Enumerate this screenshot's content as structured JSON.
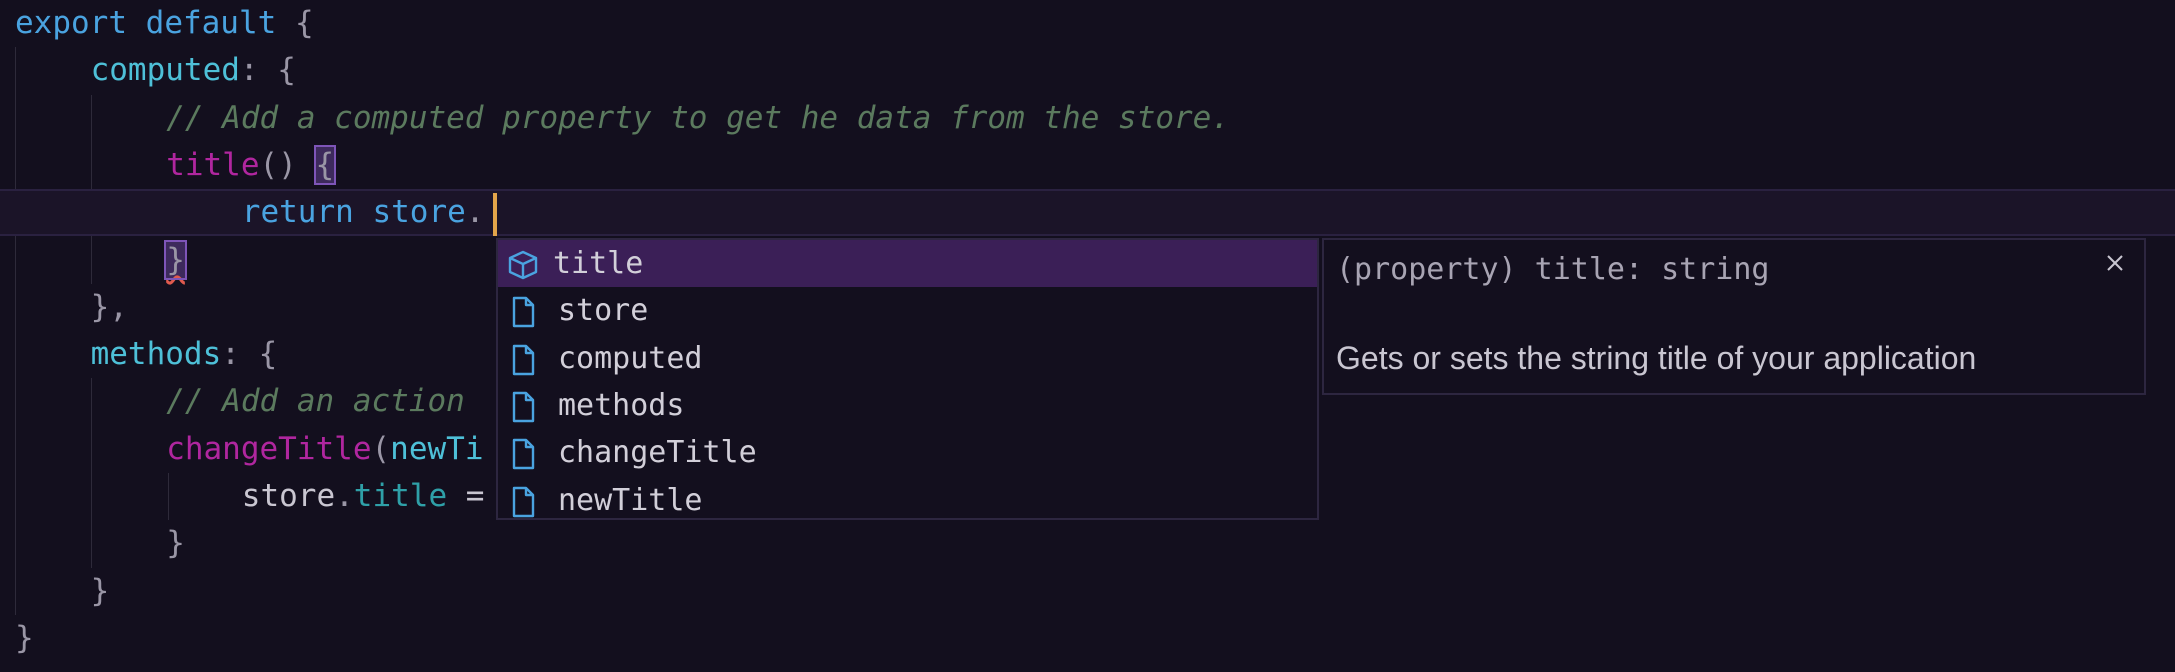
{
  "code": {
    "lines": [
      {
        "indent": 0,
        "tokens": [
          {
            "cls": "kw",
            "text": "export"
          },
          {
            "cls": "plain",
            "text": " "
          },
          {
            "cls": "kw",
            "text": "default"
          },
          {
            "cls": "plain",
            "text": " "
          },
          {
            "cls": "punc",
            "text": "{"
          }
        ]
      },
      {
        "indent": 4,
        "tokens": [
          {
            "cls": "prop",
            "text": "computed"
          },
          {
            "cls": "punc",
            "text": ": {"
          }
        ]
      },
      {
        "indent": 8,
        "tokens": [
          {
            "cls": "cm",
            "text": "// Add a computed property to get he data from the store."
          }
        ]
      },
      {
        "indent": 8,
        "tokens": [
          {
            "cls": "fn",
            "text": "title"
          },
          {
            "cls": "punc",
            "text": "() "
          },
          {
            "cls": "punc bracket-match",
            "text": "{"
          }
        ]
      },
      {
        "indent": 12,
        "current": true,
        "tokens": [
          {
            "cls": "kw",
            "text": "return"
          },
          {
            "cls": "plain",
            "text": " "
          },
          {
            "cls": "kw",
            "text": "store"
          },
          {
            "cls": "punc",
            "text": "."
          }
        ]
      },
      {
        "indent": 8,
        "tokens": [
          {
            "cls": "punc bracket-match squiggle",
            "text": "}"
          }
        ]
      },
      {
        "indent": 4,
        "tokens": [
          {
            "cls": "punc",
            "text": "},"
          }
        ]
      },
      {
        "indent": 4,
        "tokens": [
          {
            "cls": "prop",
            "text": "methods"
          },
          {
            "cls": "punc",
            "text": ": {"
          }
        ]
      },
      {
        "indent": 8,
        "tokens": [
          {
            "cls": "cm",
            "text": "// Add an action"
          }
        ]
      },
      {
        "indent": 8,
        "tokens": [
          {
            "cls": "fn",
            "text": "changeTitle"
          },
          {
            "cls": "punc",
            "text": "("
          },
          {
            "cls": "prop",
            "text": "newTi"
          }
        ]
      },
      {
        "indent": 12,
        "tokens": [
          {
            "cls": "plain",
            "text": "store"
          },
          {
            "cls": "punc",
            "text": "."
          },
          {
            "cls": "member",
            "text": "title"
          },
          {
            "cls": "plain",
            "text": " ="
          }
        ]
      },
      {
        "indent": 8,
        "tokens": [
          {
            "cls": "punc",
            "text": "}"
          }
        ]
      },
      {
        "indent": 4,
        "tokens": [
          {
            "cls": "punc",
            "text": "}"
          }
        ]
      },
      {
        "indent": 0,
        "tokens": [
          {
            "cls": "punc",
            "text": "}"
          }
        ]
      }
    ]
  },
  "suggest": {
    "items": [
      {
        "label": "title",
        "icon": "cube-icon",
        "selected": true
      },
      {
        "label": "store",
        "icon": "file-icon",
        "selected": false
      },
      {
        "label": "computed",
        "icon": "file-icon",
        "selected": false
      },
      {
        "label": "methods",
        "icon": "file-icon",
        "selected": false
      },
      {
        "label": "changeTitle",
        "icon": "file-icon",
        "selected": false
      },
      {
        "label": "newTitle",
        "icon": "file-icon",
        "selected": false
      }
    ]
  },
  "details": {
    "signature": "(property) title: string",
    "documentation": "Gets or sets the string title of your application",
    "close_icon": "close-icon"
  },
  "colors": {
    "background": "#130f1e",
    "keyword": "#4aa3e0",
    "function": "#b0269f",
    "comment": "#5b7a5e",
    "cursor": "#e3a54a",
    "selection": "#3b1f57",
    "icon": "#4aa3e0"
  }
}
